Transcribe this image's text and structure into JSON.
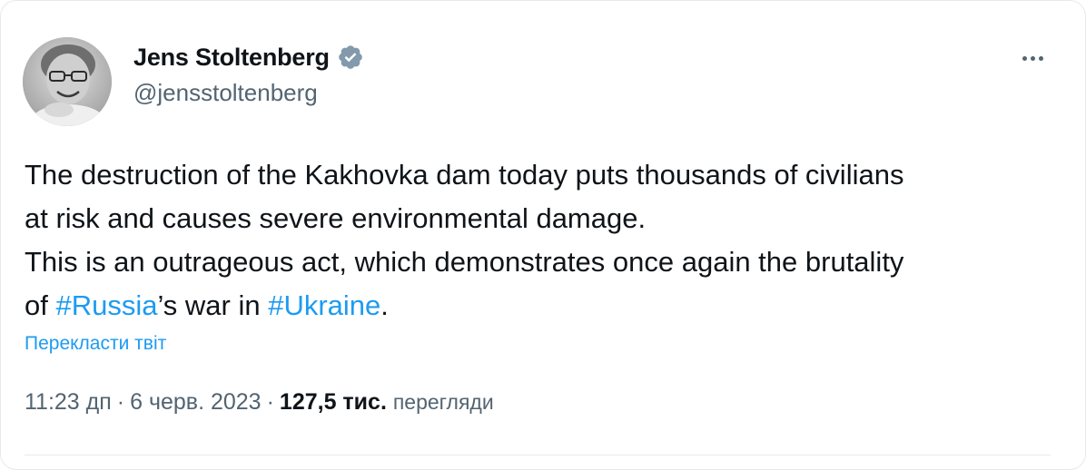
{
  "author": {
    "display_name": "Jens Stoltenberg",
    "handle": "@jensstoltenberg",
    "verified_icon": "verified-badge-icon",
    "verified_color": "#1d9bf0"
  },
  "tweet": {
    "line1": "The destruction of the Kakhovka dam today puts thousands of civilians",
    "line2": "at risk and causes severe environmental damage.",
    "line3": "This is an outrageous act, which demonstrates once again the brutality",
    "line4_prefix": "of ",
    "hashtag_russia": "#Russia",
    "line4_middle": "’s war in ",
    "hashtag_ukraine": "#Ukraine",
    "line4_suffix": "."
  },
  "translate_label": "Перекласти твіт",
  "meta": {
    "time": "11:23 дп",
    "separator": "·",
    "date": "6 черв. 2023",
    "views_count": "127,5 тис.",
    "views_label": "перегляди"
  },
  "colors": {
    "link": "#1d9bf0",
    "secondary_text": "#536471",
    "primary_text": "#0f1419"
  }
}
